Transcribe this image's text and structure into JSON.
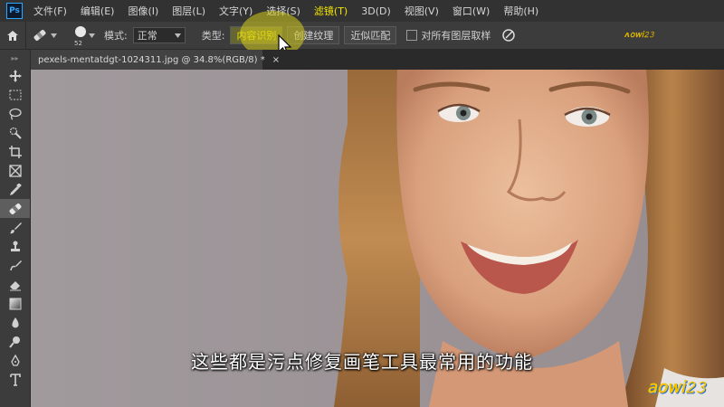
{
  "app": {
    "logo": "Ps"
  },
  "menu": [
    "文件(F)",
    "编辑(E)",
    "图像(I)",
    "图层(L)",
    "文字(Y)",
    "选择(S)",
    "滤镜(T)",
    "3D(D)",
    "视图(V)",
    "窗口(W)",
    "帮助(H)"
  ],
  "menu_highlight_index": 6,
  "options": {
    "brush_size": "52",
    "mode_label": "模式:",
    "mode_value": "正常",
    "type_label": "类型:",
    "type_buttons": [
      "内容识别",
      "创建纹理",
      "近似匹配"
    ],
    "selected_type_index": 0,
    "sample_all_layers": "对所有图层取样"
  },
  "document": {
    "tab_title": "pexels-mentatdgt-1024311.jpg @ 34.8%(RGB/8) *",
    "close": "×"
  },
  "tools": [
    "move-icon",
    "marquee-icon",
    "lasso-icon",
    "quick-select-icon",
    "crop-icon",
    "frame-icon",
    "eyedropper-icon",
    "spot-healing-brush-icon",
    "brush-icon",
    "clone-stamp-icon",
    "history-brush-icon",
    "eraser-icon",
    "gradient-icon",
    "blur-icon",
    "dodge-icon",
    "pen-icon",
    "type-icon"
  ],
  "active_tool_index": 7,
  "subtitle": "这些都是污点修复画笔工具最常用的功能",
  "watermark": {
    "top": "ᴧ𝗈𝗐𝗂𝟸𝟹",
    "bottom": "𝖺𝗈𝗐𝗂𝟸𝟹"
  },
  "colors": {
    "menu_bg": "#323232",
    "highlight": "#f2e400",
    "canvas_bg": "#9d9599"
  }
}
